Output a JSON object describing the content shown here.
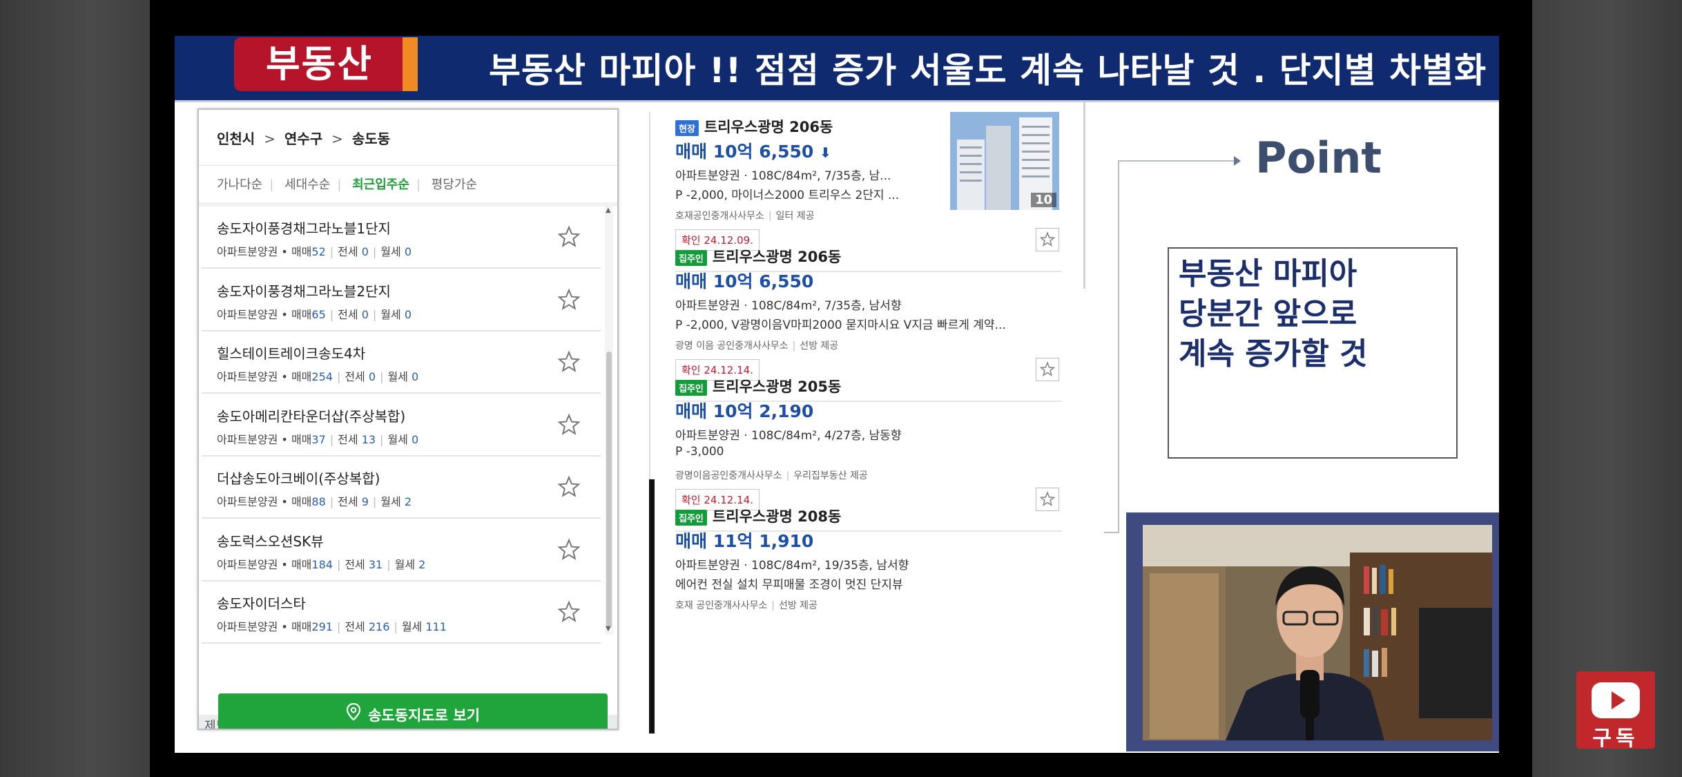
{
  "banner": {
    "badge": "부동산",
    "headline": "부동산 마피아 !! 점점 증가 서울도 계속 나타날 것 . 단지별 차별화"
  },
  "list_panel": {
    "breadcrumb": [
      "인천시",
      "연수구",
      "송도동"
    ],
    "breadcrumb_sep": ">",
    "sort_options": [
      "가나다순",
      "세대수순",
      "최근입주순",
      "평당가순"
    ],
    "active_sort": "최근입주순",
    "items": [
      {
        "name": "송도자이풍경채그라노블1단지",
        "type": "아파트분양권",
        "sale_label": "매매",
        "sale": "52",
        "jeonse_label": "전세",
        "jeonse": "0",
        "wolse_label": "월세",
        "wolse": "0"
      },
      {
        "name": "송도자이풍경채그라노블2단지",
        "type": "아파트분양권",
        "sale_label": "매매",
        "sale": "65",
        "jeonse_label": "전세",
        "jeonse": "0",
        "wolse_label": "월세",
        "wolse": "0"
      },
      {
        "name": "힐스테이트레이크송도4차",
        "type": "아파트분양권",
        "sale_label": "매매",
        "sale": "254",
        "jeonse_label": "전세",
        "jeonse": "0",
        "wolse_label": "월세",
        "wolse": "0"
      },
      {
        "name": "송도아메리칸타운더샵(주상복합)",
        "type": "아파트분양권",
        "sale_label": "매매",
        "sale": "37",
        "jeonse_label": "전세",
        "jeonse": "13",
        "wolse_label": "월세",
        "wolse": "0"
      },
      {
        "name": "더샵송도아크베이(주상복합)",
        "type": "아파트분양권",
        "sale_label": "매매",
        "sale": "88",
        "jeonse_label": "전세",
        "jeonse": "9",
        "wolse_label": "월세",
        "wolse": "2"
      },
      {
        "name": "송도럭스오션SK뷰",
        "type": "아파트분양권",
        "sale_label": "매매",
        "sale": "184",
        "jeonse_label": "전세",
        "jeonse": "31",
        "wolse_label": "월세",
        "wolse": "2"
      },
      {
        "name": "송도자이더스타",
        "type": "아파트분양권",
        "sale_label": "매매",
        "sale": "291",
        "jeonse_label": "전세",
        "jeonse": "216",
        "wolse_label": "월세",
        "wolse": "111"
      }
    ],
    "map_button": "송도동지도로 보기",
    "map_strip": "제도시"
  },
  "listings": [
    {
      "tag": "현장",
      "tag_color": "#2e6fd8",
      "title": "트리우스광명 206동",
      "price": "매매 10억 6,550",
      "price_arrow": "⬇",
      "spec": "아파트분양권 · 108C/84m², 7/35층, 남...",
      "desc": "P -2,000, 마이너스2000 트리우스 2단지 ...",
      "agent": "호재공인중개사사무소",
      "provider": "일터 제공",
      "confirm": "확인 24.12.09.",
      "photo_count": "10"
    },
    {
      "tag": "집주인",
      "tag_color": "#139c3a",
      "title": "트리우스광명 206동",
      "price": "매매 10억 6,550",
      "price_arrow": "",
      "spec": "아파트분양권 · 108C/84m², 7/35층, 남서향",
      "desc": "P -2,000, V광명이음V마피2000 묻지마시요 V지금 빠르게 계약...",
      "agent": "광명 이음 공인중개사사무소",
      "provider": "선방 제공",
      "confirm": "확인 24.12.14."
    },
    {
      "tag": "집주인",
      "tag_color": "#139c3a",
      "title": "트리우스광명 205동",
      "price": "매매 10억 2,190",
      "price_arrow": "",
      "spec": "아파트분양권 · 108C/84m², 4/27층, 남동향",
      "desc": "P -3,000",
      "agent": "광명이음공인중개사사무소",
      "provider": "우리집부동산 제공",
      "confirm": "확인 24.12.14."
    },
    {
      "tag": "집주인",
      "tag_color": "#139c3a",
      "title": "트리우스광명 208동",
      "price": "매매 11억 1,910",
      "price_arrow": "",
      "spec": "아파트분양권 · 108C/84m², 19/35층, 남서향",
      "desc": "에어컨 전실 설치 무피매물 조경이 멋진 단지뷰",
      "agent": "호재 공인중개사사무소",
      "provider": "선방 제공",
      "confirm": ""
    }
  ],
  "point": {
    "label": "Point",
    "text": "부동산 마피아\n당분간 앞으로\n계속 증가할 것"
  },
  "subscribe": {
    "label": "구독"
  },
  "colors": {
    "banner_bg": "#0f2a6e",
    "badge_bg": "#b5142a",
    "badge_accent": "#f08a24",
    "price_blue": "#1c4fa5",
    "map_button_green": "#1fa53c",
    "confirm_red": "#c21c2f",
    "subscribe_red": "#c0282b"
  }
}
